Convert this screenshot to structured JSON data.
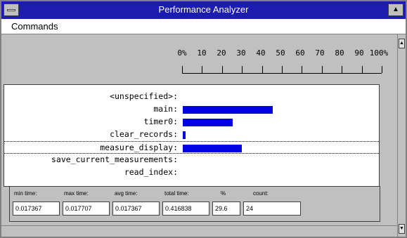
{
  "window": {
    "title": "Performance Analyzer",
    "max_glyph": "▲",
    "scroll_up_glyph": "▲",
    "scroll_down_glyph": "▼"
  },
  "menu": {
    "items": [
      "Commands"
    ]
  },
  "scale": {
    "labels": [
      "0%",
      "10",
      "20",
      "30",
      "40",
      "50",
      "60",
      "70",
      "80",
      "90",
      "100%"
    ],
    "tick_count": 11
  },
  "functions": [
    {
      "name": "<unspecified>:",
      "percent": 0
    },
    {
      "name": "main:",
      "percent": 45
    },
    {
      "name": "timer0:",
      "percent": 25
    },
    {
      "name": "clear_records:",
      "percent": 1.5
    },
    {
      "name": "measure_display:",
      "percent": 29.6
    },
    {
      "name": "save_current_measurements:",
      "percent": 0
    },
    {
      "name": "read_index:",
      "percent": 0
    }
  ],
  "selected_index": 4,
  "stats": {
    "labels": [
      "min time:",
      "max time:",
      "avg time:",
      "total time:",
      "%",
      "count:"
    ],
    "values": [
      "0.017367",
      "0.017707",
      "0.017367",
      "0.416838",
      "29.6",
      "24"
    ]
  },
  "colors": {
    "titlebar": "#1c1cb0",
    "bar": "#0000e0",
    "chrome": "#c0c0c0"
  }
}
